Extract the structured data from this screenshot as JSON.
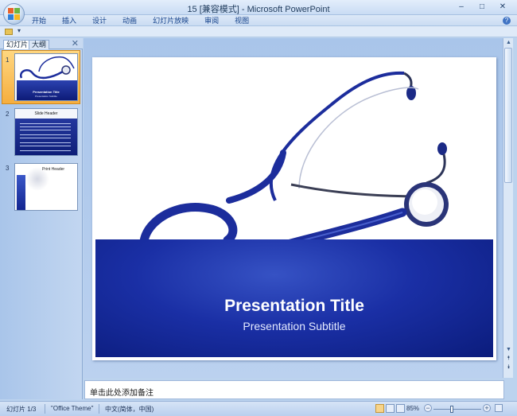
{
  "window": {
    "title": "15 [兼容模式] - Microsoft PowerPoint",
    "controls": [
      "–",
      "□",
      "✕"
    ]
  },
  "menu": {
    "items": [
      "开始",
      "插入",
      "设计",
      "动画",
      "幻灯片放映",
      "审阅",
      "视图"
    ],
    "help": "?"
  },
  "qat": {
    "arrow": "▾"
  },
  "left_panel": {
    "tabs": [
      "幻灯片",
      "大纲"
    ],
    "close": "✕",
    "thumbnails": [
      {
        "number": "1",
        "title": "Presentation Title",
        "subtitle": "Presentation Subtitle"
      },
      {
        "number": "2",
        "title": "Slide Header"
      },
      {
        "number": "3",
        "title": "Print Header"
      }
    ]
  },
  "slide": {
    "title": "Presentation Title",
    "subtitle": "Presentation Subtitle",
    "colors": {
      "band": "#1a2fa5",
      "stethoscope": "#1c2d9c"
    }
  },
  "scrollbar": {
    "up": "▲",
    "down": "▼",
    "prev": "⯭",
    "next": "⯯"
  },
  "notes": {
    "placeholder": "单击此处添加备注"
  },
  "status": {
    "slide_count": "幻灯片 1/3",
    "theme": "\"Office Theme\"",
    "language": "中文(简体，中国)",
    "zoom": "85%",
    "zoom_minus": "−",
    "zoom_plus": "+"
  }
}
